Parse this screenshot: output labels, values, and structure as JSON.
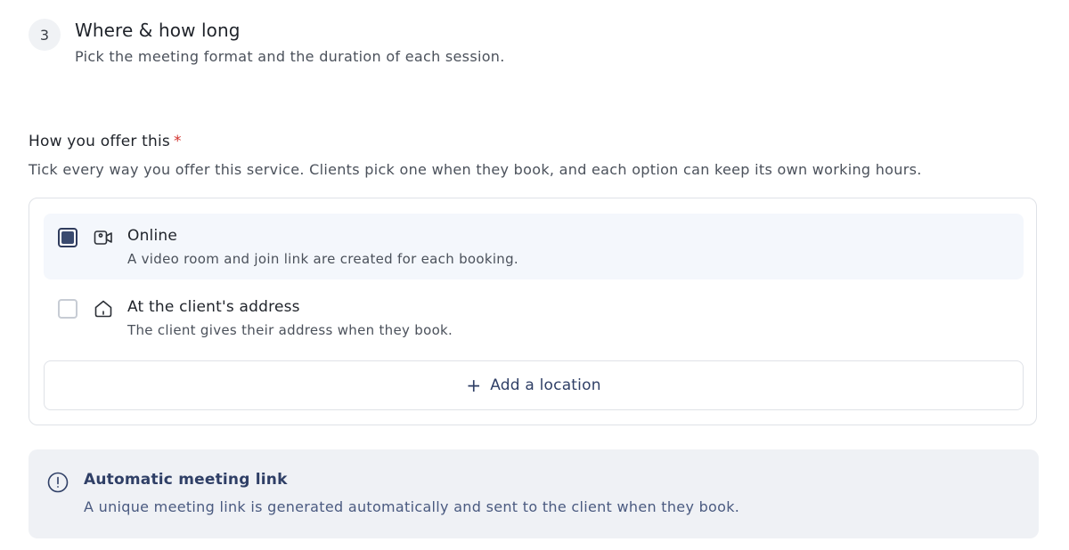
{
  "step": {
    "number": "3",
    "title": "Where & how long",
    "subtitle": "Pick the meeting format and the duration of each session."
  },
  "offer_field": {
    "label": "How you offer this",
    "required_mark": "*",
    "help": "Tick every way you offer this service. Clients pick one when they book, and each option can keep its own working hours."
  },
  "options": [
    {
      "icon": "video-camera-icon",
      "title": "Online",
      "description": "A video room and join link are created for each booking.",
      "checked": true
    },
    {
      "icon": "house-icon",
      "title": "At the client's address",
      "description": "The client gives their address when they book.",
      "checked": false
    }
  ],
  "add_location": {
    "icon": "plus-icon",
    "label": "Add a location"
  },
  "info_banner": {
    "icon": "info-icon",
    "title": "Automatic meeting link",
    "text": "A unique meeting link is generated automatically and sent to the client when they book."
  },
  "colors": {
    "accent": "#2f3f66",
    "checkbox_fill": "#3a4a6e",
    "required": "#d2332f",
    "selected_row_bg": "#f4f7fc",
    "banner_bg": "#eff1f5"
  }
}
